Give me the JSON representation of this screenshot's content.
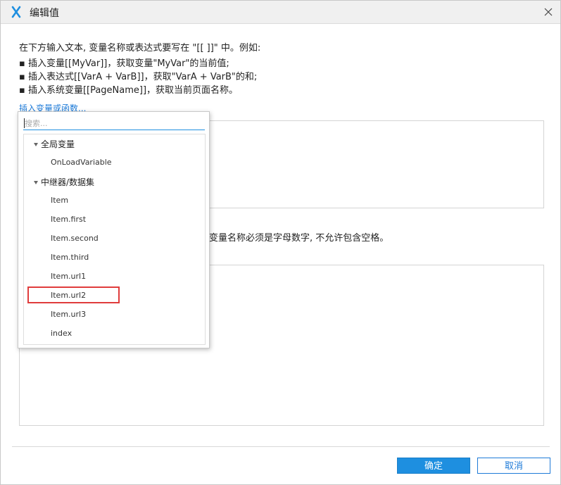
{
  "window": {
    "title": "编辑值"
  },
  "instructions": {
    "line1": "在下方输入文本, 变量名称或表达式要写在 \"[[ ]]\" 中。例如:",
    "line2": "▪ 插入变量[[MyVar]]，获取变量\"MyVar\"的当前值;",
    "line3": "▪ 插入表达式[[VarA + VarB]]，获取\"VarA + VarB\"的和;",
    "line4": "▪ 插入系统变量[[PageName]]，获取当前页面名称。"
  },
  "insert_link": "插入变量或函数...",
  "note": "部变量名称必须是字母数字, 不允许包含空格。",
  "popup": {
    "search_placeholder": "搜索...",
    "groups": [
      {
        "label": "全局变量",
        "items": [
          "OnLoadVariable"
        ]
      },
      {
        "label": "中继器/数据集",
        "items": [
          "Item",
          "Item.first",
          "Item.second",
          "Item.third",
          "Item.url1",
          "Item.url2",
          "Item.url3",
          "index"
        ]
      }
    ],
    "highlighted_item": "Item.url2"
  },
  "buttons": {
    "ok": "确定",
    "cancel": "取消"
  }
}
